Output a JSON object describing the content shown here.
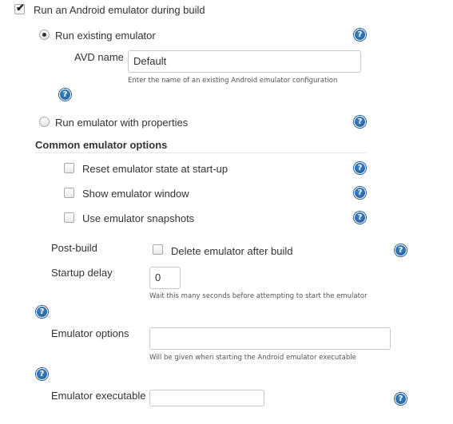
{
  "main_option": {
    "label": "Run an Android emulator during build",
    "checked": true
  },
  "run_existing": {
    "label": "Run existing emulator",
    "selected": true,
    "avd_name_label": "AVD name",
    "avd_name_value": "Default",
    "avd_name_hint": "Enter the name of an existing Android emulator configuration"
  },
  "run_with_properties": {
    "label": "Run emulator with properties",
    "selected": false
  },
  "common": {
    "heading": "Common emulator options",
    "options": [
      {
        "label": "Reset emulator state at start-up",
        "checked": false
      },
      {
        "label": "Show emulator window",
        "checked": false
      },
      {
        "label": "Use emulator snapshots",
        "checked": false
      }
    ]
  },
  "post_build": {
    "label": "Post-build",
    "option_label": "Delete emulator after build",
    "checked": false
  },
  "startup_delay": {
    "label": "Startup delay",
    "value": "0",
    "hint": "Wait this many seconds before attempting to start the emulator"
  },
  "emulator_options": {
    "label": "Emulator options",
    "value": "",
    "hint": "Will be given when starting the Android emulator executable"
  },
  "emulator_executable": {
    "label": "Emulator executable",
    "value": ""
  },
  "help_glyph": "?",
  "check_glyph": "✔",
  "colors": {
    "help_icon": "#2a6db0",
    "text": "#333333",
    "hint": "#555555"
  },
  "icons": [
    "checkbox-icon",
    "radio-icon",
    "help-icon"
  ]
}
